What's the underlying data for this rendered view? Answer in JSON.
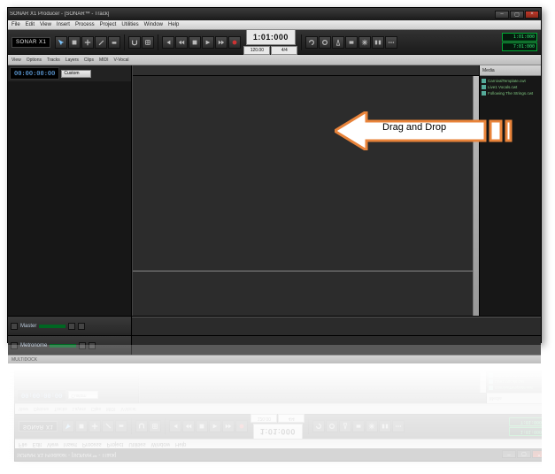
{
  "window": {
    "title": "SONAR X1 Producer - [SONAR™ - Track]"
  },
  "menu": {
    "file": "File",
    "edit": "Edit",
    "view": "View",
    "insert": "Insert",
    "process": "Process",
    "project": "Project",
    "utilities": "Utilities",
    "window": "Window",
    "help": "Help"
  },
  "brand": "SONAR X1",
  "transport": {
    "timecode": "1:01:000",
    "tempo": "120.00",
    "meter": "4/4"
  },
  "display": {
    "bars": "1:01:000",
    "time": "7:01:000"
  },
  "subtabs": {
    "view": "View",
    "options": "Options",
    "tracks": "Tracks",
    "layers": "Layers",
    "clips": "Clips",
    "midi": "MIDI",
    "vvocal": "V-Vocal"
  },
  "trackpane": {
    "counter": "00:00:00:00",
    "dropdown": "Custom"
  },
  "buses": {
    "master": "Master",
    "metronome": "Metronome"
  },
  "media": {
    "header": "Media",
    "items": [
      "CarnivalTemplate.cwt",
      "Live1 Vocals.cwt",
      "Following The Strings.cwt"
    ]
  },
  "dock": {
    "label": "MULTIDOCK"
  },
  "annotation": {
    "text": "Drag and Drop"
  }
}
